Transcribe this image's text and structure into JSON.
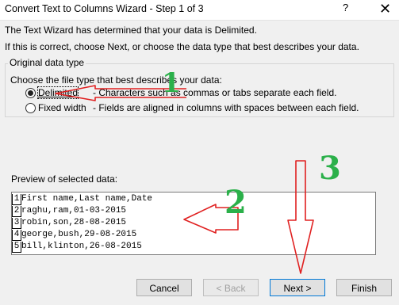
{
  "window": {
    "title": "Convert Text to Columns Wizard - Step 1 of 3",
    "help_icon": "?",
    "close_icon": "✕"
  },
  "intro": {
    "line1": "The Text Wizard has determined that your data is Delimited.",
    "line2": "If this is correct, choose Next, or choose the data type that best describes your data."
  },
  "data_type": {
    "legend": "Original data type",
    "prompt": "Choose the file type that best describes your data:",
    "options": [
      {
        "label": "Delimited",
        "description": "- Characters such as commas or tabs separate each field.",
        "selected": true
      },
      {
        "label": "Fixed width",
        "description": "- Fields are aligned in columns with spaces between each field.",
        "selected": false
      }
    ]
  },
  "preview": {
    "label": "Preview of selected data:",
    "rows": [
      {
        "num": "1",
        "text": "First name,Last name,Date"
      },
      {
        "num": "2",
        "text": "raghu,ram,01-03-2015"
      },
      {
        "num": "3",
        "text": "robin,son,28-08-2015"
      },
      {
        "num": "4",
        "text": "george,bush,29-08-2015"
      },
      {
        "num": "5",
        "text": "bill,klinton,26-08-2015"
      }
    ]
  },
  "buttons": {
    "cancel": "Cancel",
    "back": "< Back",
    "next": "Next >",
    "finish": "Finish"
  },
  "annotations": {
    "step1": "1",
    "step2": "2",
    "step3": "3",
    "arrow_color": "#e02020",
    "number_color": "#2bb04a"
  }
}
